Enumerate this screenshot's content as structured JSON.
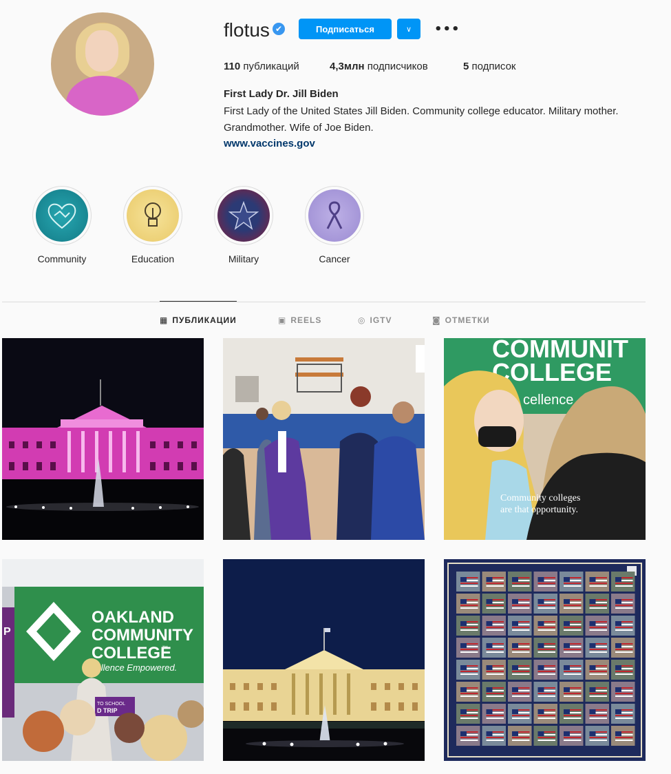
{
  "profile": {
    "username": "flotus",
    "verified_icon": "✔",
    "follow_label": "Подписаться",
    "dropdown_icon": "∨",
    "more_icon": "•••",
    "stats": {
      "posts_count": "110",
      "posts_label": "публикаций",
      "followers_count": "4,3млн",
      "followers_label": "подписчиков",
      "following_count": "5",
      "following_label": "подписок"
    },
    "full_name": "First Lady Dr. Jill Biden",
    "bio": "First Lady of the United States Jill Biden. Community college educator. Military mother. Grandmother. Wife of Joe Biden.",
    "link": "www.vaccines.gov"
  },
  "highlights": [
    {
      "label": "Community",
      "icon": "🤝",
      "color": "#1a8f9a"
    },
    {
      "label": "Education",
      "icon": "💡",
      "color": "#efd27a"
    },
    {
      "label": "Military",
      "icon": "★",
      "color": "#1e2a5a"
    },
    {
      "label": "Cancer",
      "icon": "🎗",
      "color": "#a99ad8"
    }
  ],
  "tabs": [
    {
      "label": "ПУБЛИКАЦИИ",
      "icon": "▦"
    },
    {
      "label": "REELS",
      "icon": "▣"
    },
    {
      "label": "IGTV",
      "icon": "◎"
    },
    {
      "label": "ОТМЕТКИ",
      "icon": "◙"
    }
  ],
  "posts": {
    "p3_text_top": "COMMUNIT",
    "p3_text_mid": "COLLEGE",
    "p3_text_small": "cellence",
    "p3_caption_1": "Community colleges",
    "p3_caption_2": "are that opportunity.",
    "p4_line1": "OAKLAND",
    "p4_line2": "COMMUNITY",
    "p4_line3": "COLLEGE",
    "p4_tm": "™",
    "p4_tagline": "cellence Empowered.",
    "p4_podium_1": "TO SCHOOL",
    "p4_podium_2": "D TRIP",
    "p4_side": "P"
  }
}
